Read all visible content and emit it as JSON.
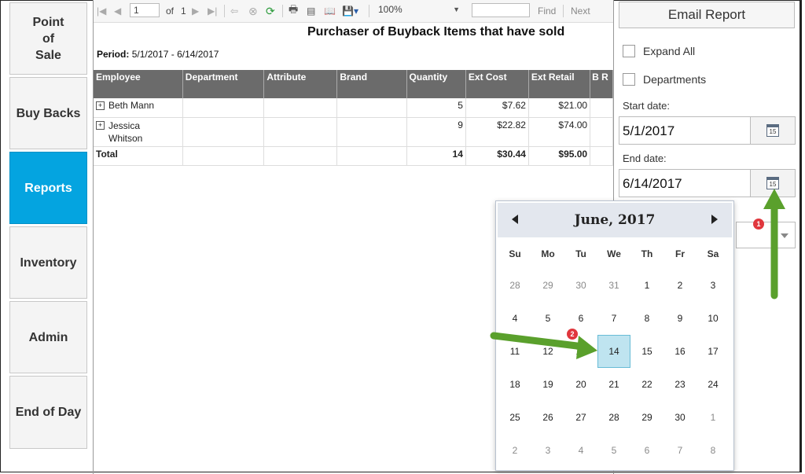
{
  "nav": {
    "items": [
      {
        "label": "Point\nof\nSale"
      },
      {
        "label": "Buy Backs"
      },
      {
        "label": "Reports"
      },
      {
        "label": "Inventory"
      },
      {
        "label": "Admin"
      },
      {
        "label": "End of Day"
      }
    ]
  },
  "toolbar": {
    "page_value": "1",
    "of_label": "of",
    "total_pages": "1",
    "zoom": "100%",
    "search_value": "",
    "find_label": "Find",
    "next_label": "Next"
  },
  "report": {
    "title": "Purchaser of Buyback Items that have sold",
    "period_label": "Period:",
    "period_value": "5/1/2017 - 6/14/2017",
    "columns": [
      "Employee",
      "Department",
      "Attribute",
      "Brand",
      "Quantity",
      "Ext Cost",
      "Ext Retail",
      "B R"
    ],
    "rows": [
      {
        "employee": "Beth Mann",
        "quantity": "5",
        "ext_cost": "$7.62",
        "ext_retail": "$21.00"
      },
      {
        "employee": "Jessica Whitson",
        "quantity": "9",
        "ext_cost": "$22.82",
        "ext_retail": "$74.00"
      }
    ],
    "total": {
      "label": "Total",
      "quantity": "14",
      "ext_cost": "$30.44",
      "ext_retail": "$95.00"
    }
  },
  "panel": {
    "email_label": "Email Report",
    "expand_all_label": "Expand All",
    "departments_label": "Departments",
    "start_label": "Start date:",
    "start_value": "5/1/2017",
    "end_label": "End date:",
    "end_value": "6/14/2017",
    "cal_icon_text": "15"
  },
  "calendar": {
    "title": "June, 2017",
    "dow": [
      "Su",
      "Mo",
      "Tu",
      "We",
      "Th",
      "Fr",
      "Sa"
    ],
    "weeks": [
      [
        "28",
        "29",
        "30",
        "31",
        "1",
        "2",
        "3"
      ],
      [
        "4",
        "5",
        "6",
        "7",
        "8",
        "9",
        "10"
      ],
      [
        "11",
        "12",
        "13",
        "14",
        "15",
        "16",
        "17"
      ],
      [
        "18",
        "19",
        "20",
        "21",
        "22",
        "23",
        "24"
      ],
      [
        "25",
        "26",
        "27",
        "28",
        "29",
        "30",
        "1"
      ],
      [
        "2",
        "3",
        "4",
        "5",
        "6",
        "7",
        "8"
      ]
    ],
    "selected": "14"
  },
  "annotations": {
    "badge_1": "1",
    "badge_2": "2",
    "arrow_color": "#5aa02c",
    "badge_color": "#e0373d"
  },
  "colors": {
    "nav_active": "#04a4e0",
    "header_bg": "#6b6b6b",
    "selected_day": "#bfe4f0"
  }
}
